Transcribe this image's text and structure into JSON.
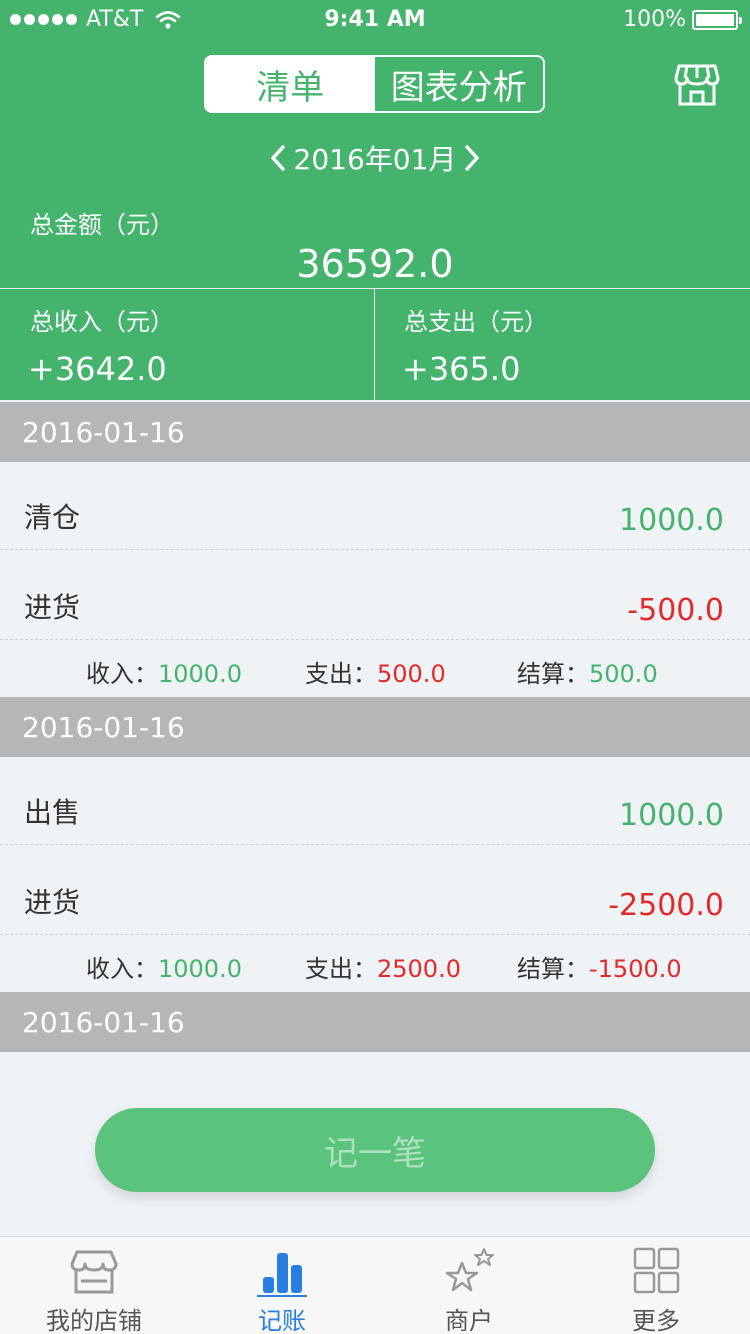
{
  "status": {
    "carrier": "AT&T",
    "time": "9:41 AM",
    "battery": "100%"
  },
  "segment": {
    "list": "清单",
    "chart": "图表分析"
  },
  "month": "2016年01月",
  "total": {
    "label": "总金额（元）",
    "value": "36592.0"
  },
  "income": {
    "label": "总收入（元）",
    "value": "+3642.0"
  },
  "expense": {
    "label": "总支出（元）",
    "value": "+365.0"
  },
  "groups": [
    {
      "date": "2016-01-16",
      "rows": [
        {
          "name": "清仓",
          "amount": "1000.0"
        },
        {
          "name": "进货",
          "amount": "-500.0"
        }
      ],
      "summary": {
        "income_label": "收入：",
        "income": "1000.0",
        "expense_label": "支出：",
        "expense": "500.0",
        "settle_label": "结算：",
        "settle": "500.0"
      }
    },
    {
      "date": "2016-01-16",
      "rows": [
        {
          "name": "出售",
          "amount": "1000.0"
        },
        {
          "name": "进货",
          "amount": "-2500.0"
        }
      ],
      "summary": {
        "income_label": "收入：",
        "income": "1000.0",
        "expense_label": "支出：",
        "expense": "2500.0",
        "settle_label": "结算：",
        "settle": "-1500.0"
      }
    },
    {
      "date": "2016-01-16"
    }
  ],
  "fab": "记一笔",
  "tabs": [
    {
      "label": "我的店铺",
      "icon": "store-icon"
    },
    {
      "label": "记账",
      "icon": "bar-chart-icon"
    },
    {
      "label": "商户",
      "icon": "stars-icon"
    },
    {
      "label": "更多",
      "icon": "grid-icon"
    }
  ],
  "colors": {
    "primary": "#44b36c",
    "income": "#44b36c",
    "expense": "#e32a2a",
    "tab_active": "#2a7de1"
  }
}
